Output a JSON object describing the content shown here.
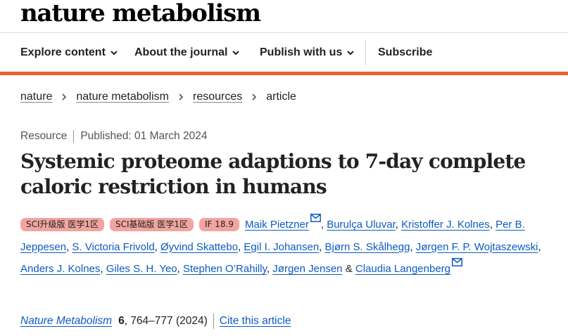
{
  "brand": {
    "logo_text": "nature metabolism"
  },
  "nav": {
    "items": [
      {
        "label": "Explore content"
      },
      {
        "label": "About the journal"
      },
      {
        "label": "Publish with us"
      },
      {
        "label": "Subscribe"
      }
    ]
  },
  "breadcrumb": {
    "items": [
      "nature",
      "nature metabolism",
      "resources",
      "article"
    ]
  },
  "article": {
    "type": "Resource",
    "published": "Published: 01 March 2024",
    "title": "Systemic proteome adaptions to 7-day complete caloric restriction in humans",
    "badges": [
      "SCI升级版 医学1区",
      "SCI基础版 医学1区",
      "IF 18.9"
    ],
    "authors": [
      "Maik Pietzner",
      "Burulça Uluvar",
      "Kristoffer J. Kolnes",
      "Per B. Jeppesen",
      "S. Victoria Frivold",
      "Øyvind Skattebo",
      "Egil I. Johansen",
      "Bjørn S. Skålhegg",
      "Jørgen F. P. Wojtaszewski",
      "Anders J. Kolnes",
      "Giles S. H. Yeo",
      "Stephen O’Rahilly",
      "Jørgen Jensen",
      "Claudia Langenberg"
    ],
    "author_conjunction": "&",
    "citation": {
      "journal": "Nature Metabolism",
      "volume": "6",
      "pages_year": ", 764–777 (2024)",
      "cite_label": "Cite this article"
    }
  },
  "colors": {
    "accent": "#e8612c",
    "link": "#0b5bc2",
    "badge": "#f2a5a0"
  },
  "icons": [
    "chevron-down-icon",
    "chevron-right-icon",
    "mail-icon"
  ]
}
